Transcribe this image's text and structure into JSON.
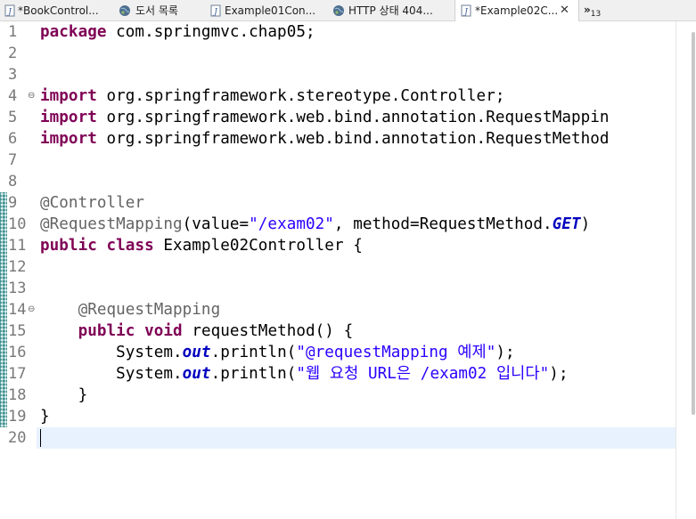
{
  "tabs": [
    {
      "label": "*BookControl...",
      "icon": "java-file-icon"
    },
    {
      "label": "도서 목록",
      "icon": "globe-icon"
    },
    {
      "label": "Example01Con...",
      "icon": "java-file-icon"
    },
    {
      "label": "HTTP 상태 404...",
      "icon": "globe-icon"
    },
    {
      "label": "*Example02C...",
      "icon": "java-file-icon",
      "active": true
    }
  ],
  "tab_close": "✕",
  "overflow": {
    "glyph": "»",
    "count": "13"
  },
  "editor": {
    "lines": [
      {
        "n": "1",
        "tokens": [
          {
            "t": "package",
            "c": "kw"
          },
          {
            "t": " com.springmvc.chap05;"
          }
        ]
      },
      {
        "n": "2",
        "tokens": []
      },
      {
        "n": "3",
        "tokens": []
      },
      {
        "n": "4",
        "fold": "⊖",
        "tokens": [
          {
            "t": "import",
            "c": "kw"
          },
          {
            "t": " org.springframework.stereotype.Controller;"
          }
        ]
      },
      {
        "n": "5",
        "tokens": [
          {
            "t": "import",
            "c": "kw"
          },
          {
            "t": " org.springframework.web.bind.annotation.RequestMappin"
          }
        ]
      },
      {
        "n": "6",
        "tokens": [
          {
            "t": "import",
            "c": "kw"
          },
          {
            "t": " org.springframework.web.bind.annotation.RequestMethod"
          }
        ]
      },
      {
        "n": "7",
        "tokens": []
      },
      {
        "n": "8",
        "tokens": []
      },
      {
        "n": "9",
        "tokens": [
          {
            "t": "@Controller",
            "c": "ann"
          }
        ]
      },
      {
        "n": "10",
        "tokens": [
          {
            "t": "@RequestMapping",
            "c": "ann"
          },
          {
            "t": "(value="
          },
          {
            "t": "\"/exam02\"",
            "c": "str"
          },
          {
            "t": ", method=RequestMethod."
          },
          {
            "t": "GET",
            "c": "fld"
          },
          {
            "t": ")"
          }
        ]
      },
      {
        "n": "11",
        "tokens": [
          {
            "t": "public",
            "c": "kw"
          },
          {
            "t": " "
          },
          {
            "t": "class",
            "c": "kw"
          },
          {
            "t": " Example02Controller {"
          }
        ]
      },
      {
        "n": "12",
        "tokens": []
      },
      {
        "n": "13",
        "tokens": []
      },
      {
        "n": "14",
        "fold": "⊖",
        "tokens": [
          {
            "t": "    "
          },
          {
            "t": "@RequestMapping",
            "c": "ann"
          }
        ]
      },
      {
        "n": "15",
        "tokens": [
          {
            "t": "    "
          },
          {
            "t": "public",
            "c": "kw"
          },
          {
            "t": " "
          },
          {
            "t": "void",
            "c": "kw"
          },
          {
            "t": " requestMethod() {"
          }
        ]
      },
      {
        "n": "16",
        "tokens": [
          {
            "t": "        System."
          },
          {
            "t": "out",
            "c": "fld"
          },
          {
            "t": ".println("
          },
          {
            "t": "\"@requestMapping 예제\"",
            "c": "str"
          },
          {
            "t": ");"
          }
        ]
      },
      {
        "n": "17",
        "tokens": [
          {
            "t": "        System."
          },
          {
            "t": "out",
            "c": "fld"
          },
          {
            "t": ".println("
          },
          {
            "t": "\"웹 요청 URL은 /exam02 입니다\"",
            "c": "str"
          },
          {
            "t": ");"
          }
        ]
      },
      {
        "n": "18",
        "tokens": [
          {
            "t": "    }"
          }
        ]
      },
      {
        "n": "19",
        "tokens": [
          {
            "t": "}"
          }
        ]
      },
      {
        "n": "20",
        "current": true,
        "tokens": []
      }
    ]
  },
  "colors": {
    "keyword": "#7f0055",
    "annotation": "#646464",
    "string": "#2a00ff",
    "static_field": "#0000c0",
    "current_line": "#e8f2fe"
  }
}
